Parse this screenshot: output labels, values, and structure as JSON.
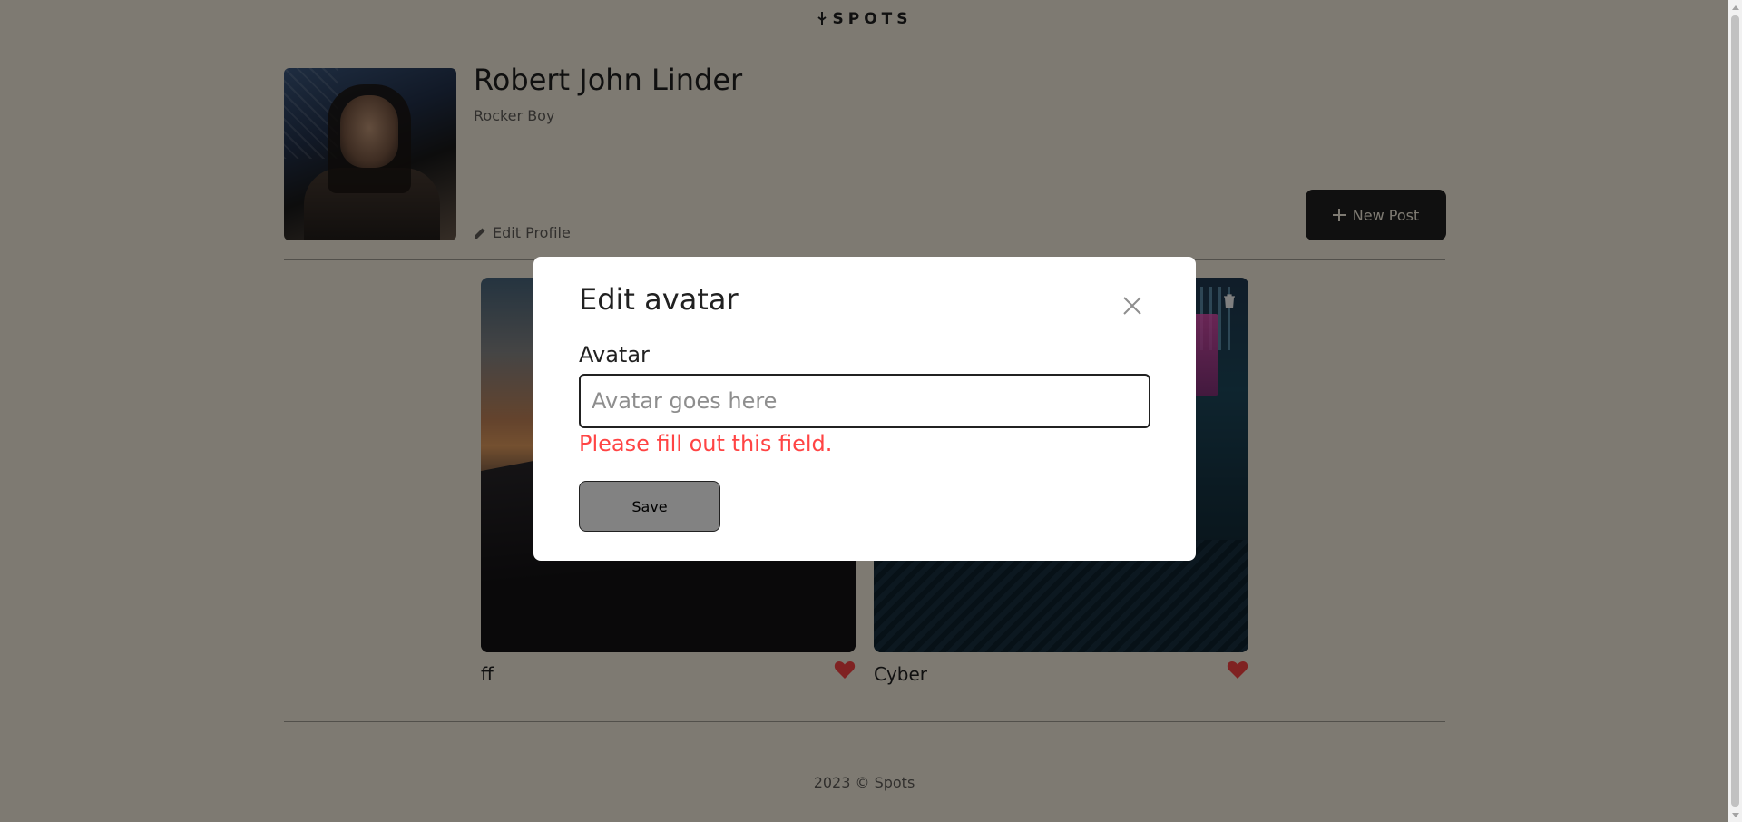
{
  "header": {
    "logo_text": "SPOTS"
  },
  "profile": {
    "name": "Robert John Linder",
    "role": "Rocker Boy",
    "edit_label": "Edit Profile",
    "new_post_label": "New Post"
  },
  "cards": [
    {
      "title": "ff",
      "liked": true
    },
    {
      "title": "Cyber",
      "liked": true
    }
  ],
  "footer": {
    "text": "2023 © Spots"
  },
  "modal": {
    "title": "Edit avatar",
    "field_label": "Avatar",
    "field_value": "",
    "field_placeholder": "Avatar goes here",
    "error_message": "Please fill out this field.",
    "save_label": "Save"
  },
  "colors": {
    "background": "#fcf5e5",
    "text": "#212121",
    "error": "#ff4444",
    "like": "#ff4444",
    "save_disabled": "#828282"
  },
  "icons": [
    "logo-icon",
    "pencil-icon",
    "plus-icon",
    "trash-icon",
    "heart-icon",
    "close-icon"
  ]
}
